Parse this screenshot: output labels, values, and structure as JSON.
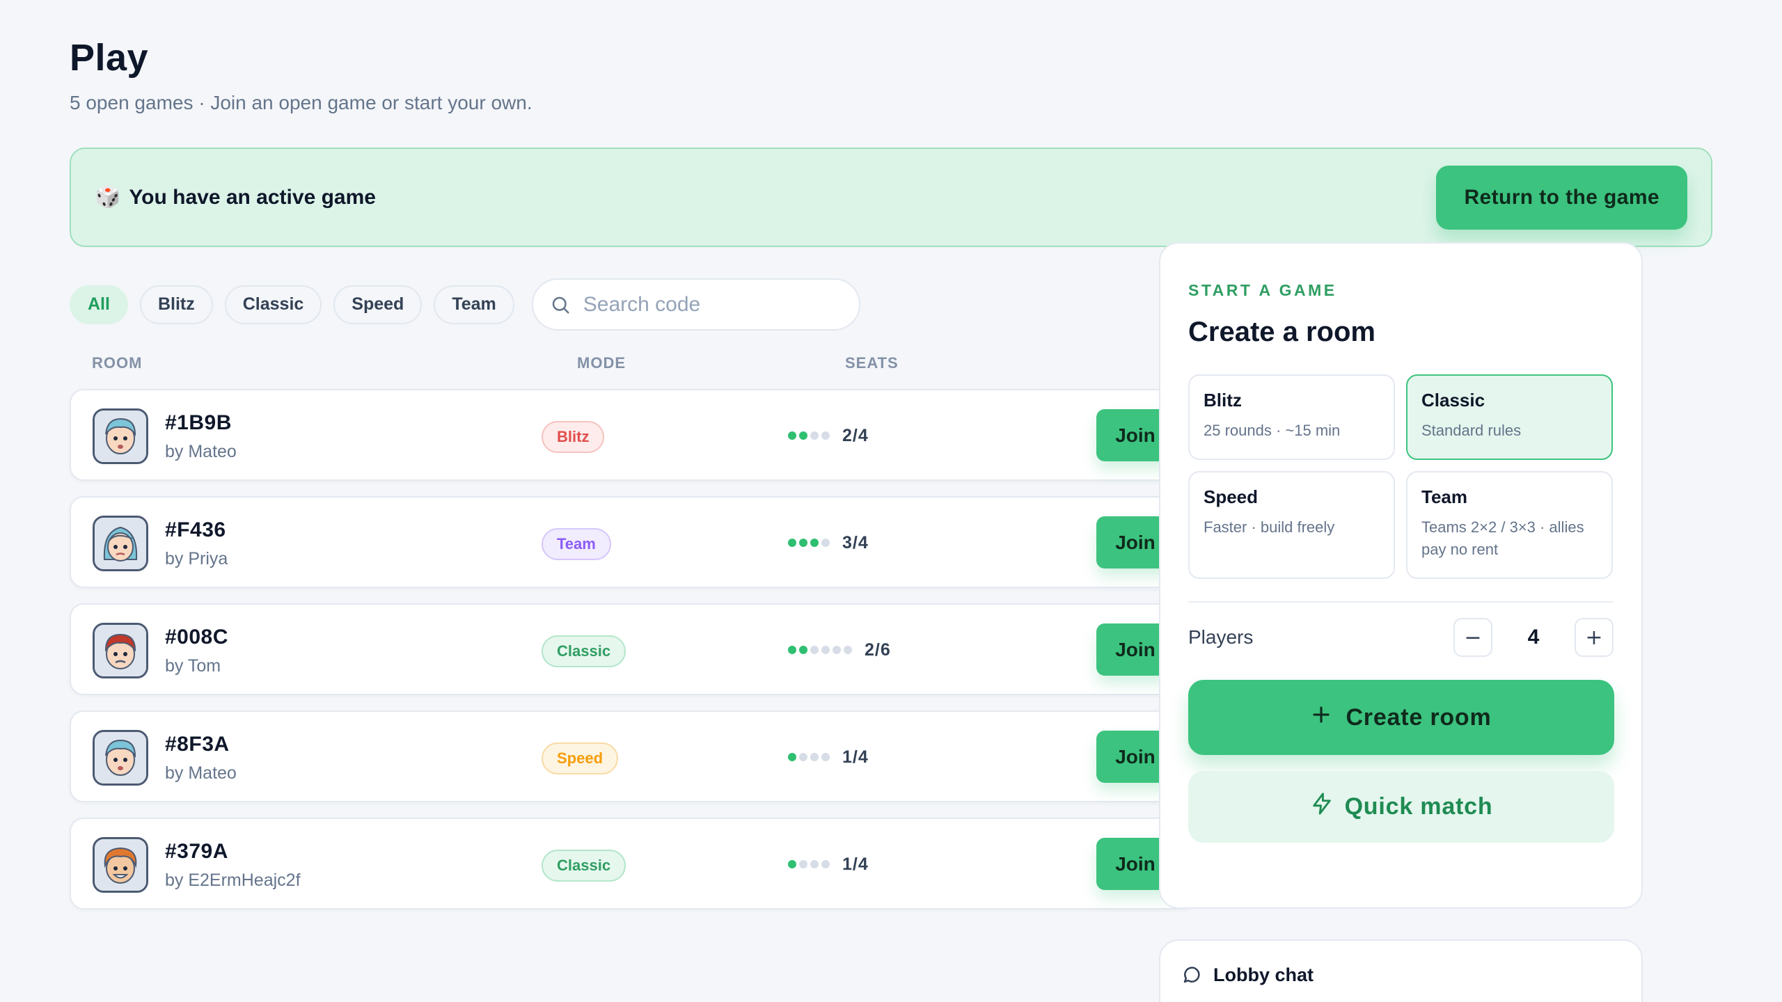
{
  "page": {
    "title": "Play",
    "subtitle": "5 open games · Join an open game or start your own."
  },
  "banner": {
    "icon": "dice-icon",
    "text": "You have an active game",
    "button_label": "Return to the game"
  },
  "filters": {
    "chips": [
      "All",
      "Blitz",
      "Classic",
      "Speed",
      "Team"
    ],
    "selected": "All",
    "search_placeholder": "Search code",
    "search_value": ""
  },
  "table": {
    "headers": {
      "room": "ROOM",
      "mode": "MODE",
      "seats": "SEATS"
    },
    "rooms": [
      {
        "code": "#1B9B",
        "owner": "by Mateo",
        "mode": "Blitz",
        "seats_taken": 2,
        "seats_total": 4,
        "seats_label": "2/4",
        "join_label": "Join",
        "avatar": "boy-blue-hair-avatar"
      },
      {
        "code": "#F436",
        "owner": "by Priya",
        "mode": "Team",
        "seats_taken": 3,
        "seats_total": 4,
        "seats_label": "3/4",
        "join_label": "Join",
        "avatar": "girl-blue-hair-avatar"
      },
      {
        "code": "#008C",
        "owner": "by Tom",
        "mode": "Classic",
        "seats_taken": 2,
        "seats_total": 6,
        "seats_label": "2/6",
        "join_label": "Join",
        "avatar": "boy-red-hair-avatar"
      },
      {
        "code": "#8F3A",
        "owner": "by Mateo",
        "mode": "Speed",
        "seats_taken": 1,
        "seats_total": 4,
        "seats_label": "1/4",
        "join_label": "Join",
        "avatar": "boy-blue-hair-avatar"
      },
      {
        "code": "#379A",
        "owner": "by E2ErmHeajc2f",
        "mode": "Classic",
        "seats_taken": 1,
        "seats_total": 4,
        "seats_label": "1/4",
        "join_label": "Join",
        "avatar": "boy-orange-hair-avatar"
      }
    ]
  },
  "mode_colors": {
    "Blitz": {
      "text": "#e14d4d",
      "bg": "#fdeceb",
      "border": "#f6c3c0"
    },
    "Team": {
      "text": "#8b5cf6",
      "bg": "#f1ecfe",
      "border": "#d7c8fb"
    },
    "Classic": {
      "text": "#2f9e62",
      "bg": "#e6f7ee",
      "border": "#b4e6cb"
    },
    "Speed": {
      "text": "#f59e0b",
      "bg": "#fef4e2",
      "border": "#f8dba6"
    }
  },
  "panel": {
    "eyebrow": "START A GAME",
    "title": "Create a room",
    "modes": [
      {
        "name": "Blitz",
        "desc": "25 rounds · ~15 min",
        "selected": false
      },
      {
        "name": "Classic",
        "desc": "Standard rules",
        "selected": true
      },
      {
        "name": "Speed",
        "desc": "Faster · build freely",
        "selected": false
      },
      {
        "name": "Team",
        "desc": "Teams 2×2 / 3×3 · allies pay no rent",
        "selected": false
      }
    ],
    "players_label": "Players",
    "players_value": "4",
    "decrement": "−",
    "increment": "+",
    "create_label": "Create room",
    "quick_label": "Quick match"
  },
  "chat": {
    "title": "Lobby chat"
  },
  "colors": {
    "accent": "#3cc37f",
    "accent_light": "#e4f6ed",
    "banner_bg": "#dcf4e8",
    "background": "#f4f6f9"
  }
}
